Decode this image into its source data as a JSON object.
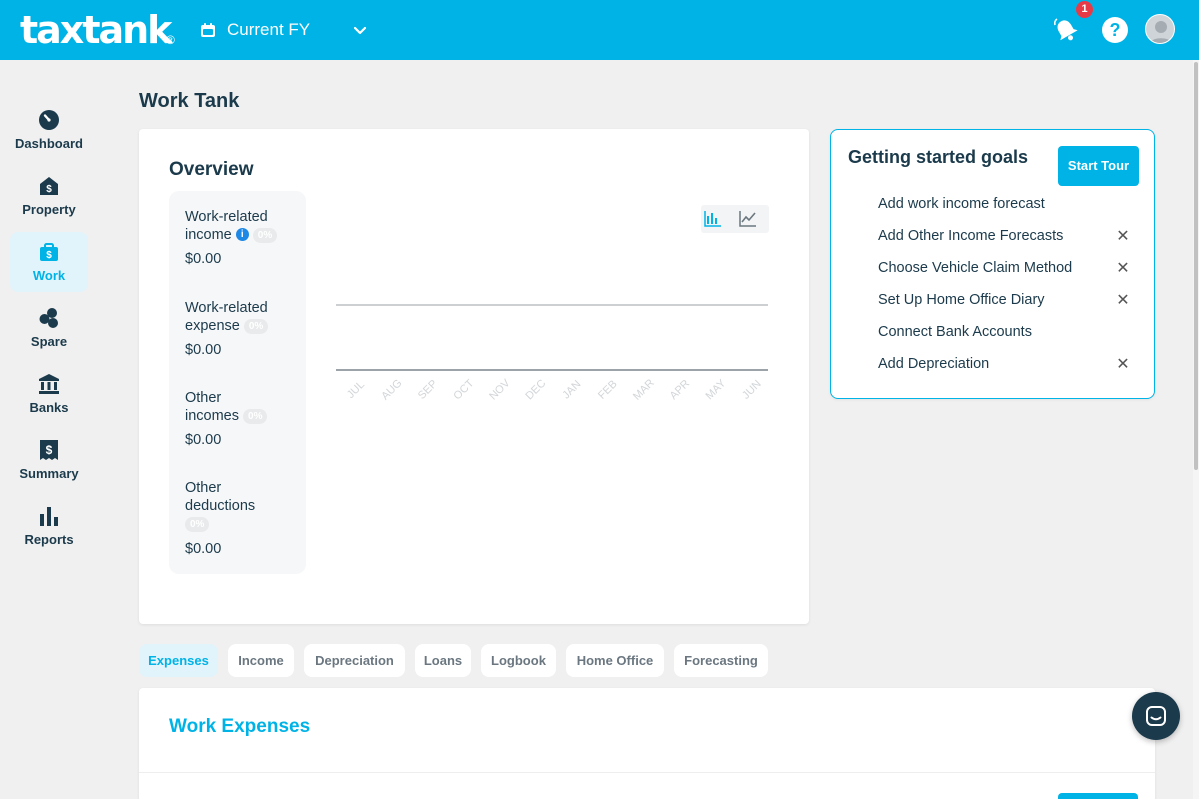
{
  "header": {
    "logo_text": "taxtank",
    "logo_reg": "®",
    "fy_label": "Current FY",
    "notification_count": "1",
    "help_label": "?",
    "brand_color": "#00b3e6"
  },
  "sidebar": {
    "items": [
      {
        "label": "Dashboard",
        "icon": "gauge-icon"
      },
      {
        "label": "Property",
        "icon": "house-dollar-icon"
      },
      {
        "label": "Work",
        "icon": "briefcase-dollar-icon",
        "active": true
      },
      {
        "label": "Spare",
        "icon": "coins-icon"
      },
      {
        "label": "Banks",
        "icon": "bank-icon"
      },
      {
        "label": "Summary",
        "icon": "receipt-dollar-icon"
      },
      {
        "label": "Reports",
        "icon": "bar-chart-icon"
      }
    ]
  },
  "page": {
    "title": "Work Tank"
  },
  "overview": {
    "title": "Overview",
    "stats": [
      {
        "label_line1": "Work-related",
        "label_line2": "income",
        "percent": "0%",
        "value": "$0.00"
      },
      {
        "label_line1": "Work-related",
        "label_line2": "expense",
        "percent": "0%",
        "value": "$0.00"
      },
      {
        "label_line1": "Other",
        "label_line2": "incomes",
        "percent": "0%",
        "value": "$0.00"
      },
      {
        "label_line1": "Other",
        "label_line2": "deductions",
        "percent": "0%",
        "value": "$0.00"
      }
    ],
    "info_glyph": "i"
  },
  "chart_data": {
    "type": "bar",
    "categories": [
      "JUL",
      "AUG",
      "SEP",
      "OCT",
      "NOV",
      "DEC",
      "JAN",
      "FEB",
      "MAR",
      "APR",
      "MAY",
      "JUN"
    ],
    "series": [],
    "title": "",
    "xlabel": "",
    "ylabel": "",
    "grid": true
  },
  "goals": {
    "title": "Getting started goals",
    "start_tour_label": "Start Tour",
    "items": [
      {
        "label": "Add work income forecast",
        "dismissible": false
      },
      {
        "label": "Add Other Income Forecasts",
        "dismissible": true
      },
      {
        "label": "Choose Vehicle Claim Method",
        "dismissible": true
      },
      {
        "label": "Set Up Home Office Diary",
        "dismissible": true
      },
      {
        "label": "Connect Bank Accounts",
        "dismissible": false
      },
      {
        "label": "Add Depreciation",
        "dismissible": true
      }
    ],
    "dismiss_glyph": "✕"
  },
  "tabs": [
    {
      "label": "Expenses",
      "active": true
    },
    {
      "label": "Income"
    },
    {
      "label": "Depreciation"
    },
    {
      "label": "Loans"
    },
    {
      "label": "Logbook"
    },
    {
      "label": "Home Office"
    },
    {
      "label": "Forecasting"
    }
  ],
  "expenses": {
    "title": "Work Expenses"
  }
}
